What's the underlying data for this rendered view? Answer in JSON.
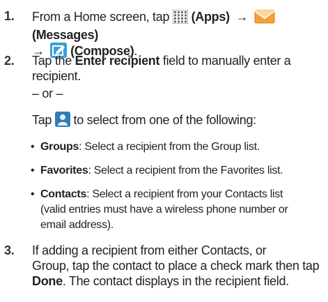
{
  "step1": {
    "num": "1.",
    "text_before_apps": "From a Home screen, tap",
    "apps_label": "(Apps)",
    "arrow": "→",
    "messages_label": "(Messages)",
    "compose_label": "(Compose)",
    "end_punct": "."
  },
  "step2": {
    "num": "2.",
    "tap_word": "Tap the",
    "field_name": "Enter recipient",
    "rest_line1": "field to manually enter a",
    "rest_line2": "recipient.",
    "or_text": "– or –",
    "tap_icon_prefix": "Tap",
    "tap_icon_suffix": "to select from one of the following:",
    "bullets": [
      {
        "term": "Groups",
        "desc": ": Select a recipient from the Group list."
      },
      {
        "term": "Favorites",
        "desc": ": Select a recipient from the Favorites list."
      },
      {
        "term": "Contacts",
        "desc": ": Select a recipient from your Contacts list"
      }
    ],
    "contacts_cont_line1": "(valid entries must have a wireless phone number or",
    "contacts_cont_line2": "email address)."
  },
  "step3": {
    "num": "3.",
    "line1": "If adding a recipient from either Contacts, or",
    "line2": "Group, tap the contact to place a check mark then tap",
    "done_label": "Done",
    "line3_rest": ". The contact displays in the recipient field."
  },
  "colors": {
    "text": "#222222",
    "messages_envelope": "#f08a1c",
    "compose_bg": "#3aa0d8",
    "contact_bg": "#2e7fb8"
  }
}
